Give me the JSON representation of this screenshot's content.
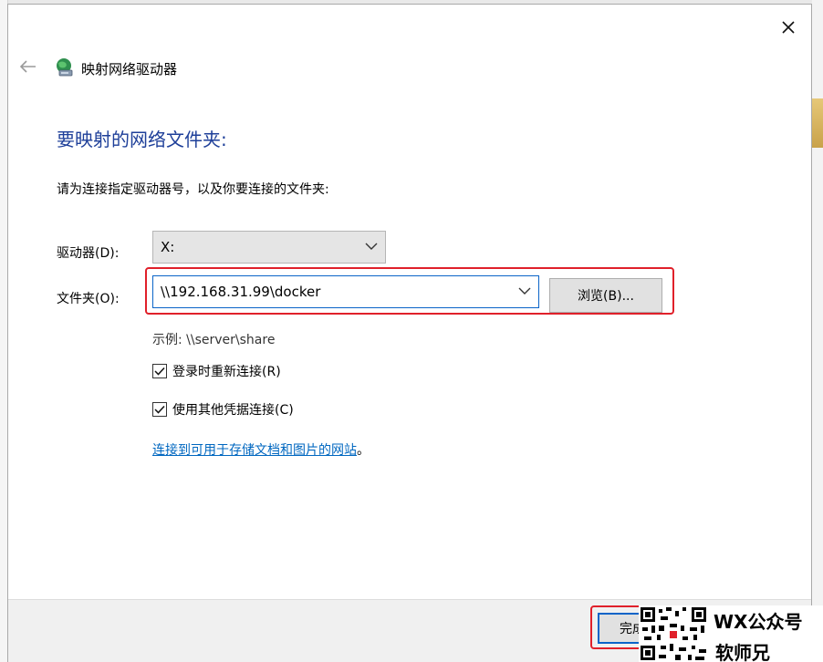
{
  "window": {
    "title": "映射网络驱动器"
  },
  "heading": "要映射的网络文件夹:",
  "instructions": "请为连接指定驱动器号，以及你要连接的文件夹:",
  "drive": {
    "label": "驱动器(D):",
    "value": "X:"
  },
  "folder": {
    "label": "文件夹(O):",
    "value": "\\\\192.168.31.99\\docker",
    "browse_label": "浏览(B)..."
  },
  "example": "示例: \\\\server\\share",
  "checkboxes": [
    {
      "label": "登录时重新连接(R)",
      "checked": true
    },
    {
      "label": "使用其他凭据连接(C)",
      "checked": true
    }
  ],
  "link": {
    "text": "连接到可用于存储文档和图片的网站",
    "suffix": "。"
  },
  "footer": {
    "finish_label": "完成"
  },
  "watermark": {
    "line1": "WX公众号",
    "line2": "软师兄"
  },
  "colors": {
    "heading": "#1e3f99",
    "link": "#0067c0",
    "highlight": "#e0202a",
    "focus_border": "#0a64c8"
  },
  "icons": {
    "close": "close-icon",
    "back": "back-arrow-icon",
    "network_drive": "network-drive-icon",
    "dropdown": "chevron-down-icon",
    "check": "checkmark-icon"
  }
}
